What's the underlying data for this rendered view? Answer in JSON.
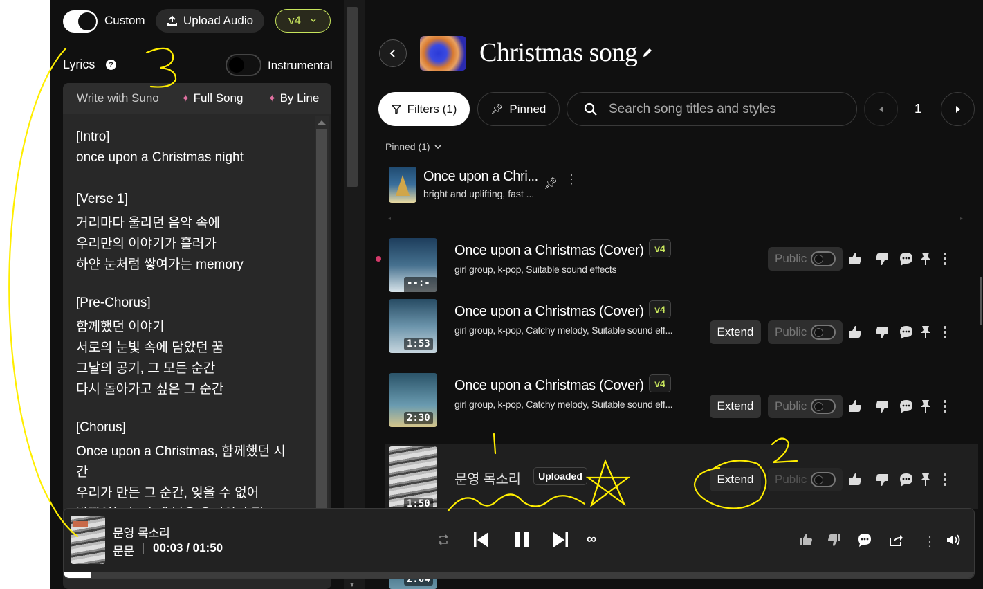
{
  "create": {
    "custom_label": "Custom",
    "upload_label": "Upload Audio",
    "version": "v4",
    "lyrics_label": "Lyrics",
    "help_glyph": "?",
    "instrumental_label": "Instrumental",
    "tabs": {
      "write": "Write with Suno",
      "full": "Full Song",
      "line": "By Line"
    },
    "lyrics_lines": [
      "[Intro]",
      "once upon a Christmas night",
      "",
      "[Verse 1]",
      "거리마다 울리던 음악 속에",
      "우리만의 이야기가 흘러가",
      "하얀 눈처럼 쌓여가는 memory",
      "",
      "[Pre-Chorus]",
      "함께했던 이야기",
      "서로의 눈빛 속에 담았던 꿈",
      "그날의 공기, 그 모든 순간",
      "다시 돌아가고 싶은 그 순간",
      "",
      "[Chorus]",
      "Once upon a Christmas, 함께했던 시",
      "간",
      "우리가 만든 그 순간, 잊을 수 없어",
      "반짝이는 눈 속에 남은 우리의 흔적"
    ]
  },
  "workspace": {
    "title": "Christmas song",
    "filters_label": "Filters (1)",
    "pinned_button": "Pinned",
    "search_placeholder": "Search song titles and styles",
    "page_number": "1",
    "pinned_header": "Pinned (1)",
    "pinned_song": {
      "title": "Once upon a Chri...",
      "style": "bright and uplifting, fast ..."
    }
  },
  "songs": [
    {
      "title": "Once upon a Christmas (Cover)",
      "style": "girl group, k-pop, Suitable sound effects",
      "badge": "v4",
      "duration": "--:--",
      "extend": "",
      "public": "Public"
    },
    {
      "title": "Once upon a Christmas (Cover)",
      "style": "girl group, k-pop, Catchy melody, Suitable sound eff...",
      "badge": "v4",
      "duration": "1:53",
      "extend": "Extend",
      "public": "Public"
    },
    {
      "title": "Once upon a Christmas (Cover)",
      "style": "girl group, k-pop, Catchy melody, Suitable sound eff...",
      "badge": "v4",
      "duration": "2:30",
      "extend": "Extend",
      "public": "Public"
    },
    {
      "title": "문영 목소리",
      "style": "",
      "badge": "Uploaded",
      "duration": "1:50",
      "extend": "Extend",
      "public": "Public"
    }
  ],
  "partial_row_duration": "2:04",
  "player": {
    "title": "문영 목소리",
    "artist": "문문",
    "separator": "|",
    "time": "00:03 / 01:50",
    "progress_fraction": 0.03
  },
  "annotations": {
    "n1": "1",
    "n2": "2",
    "n3": "3"
  },
  "colors": {
    "accent_badge": "#c7e55c",
    "annotation": "#ffee00",
    "bg": "#101010"
  },
  "icons": [
    "upload-icon",
    "chevron-down-icon",
    "help-icon",
    "sparkle-icon",
    "back-icon",
    "edit-icon",
    "filter-icon",
    "pin-icon",
    "search-icon",
    "prev-page-icon",
    "next-page-icon",
    "more-icon",
    "thumbs-up-icon",
    "thumbs-down-icon",
    "comment-icon",
    "repeat-icon",
    "skip-back-icon",
    "pause-icon",
    "skip-forward-icon",
    "infinite-icon",
    "share-icon",
    "volume-icon"
  ]
}
